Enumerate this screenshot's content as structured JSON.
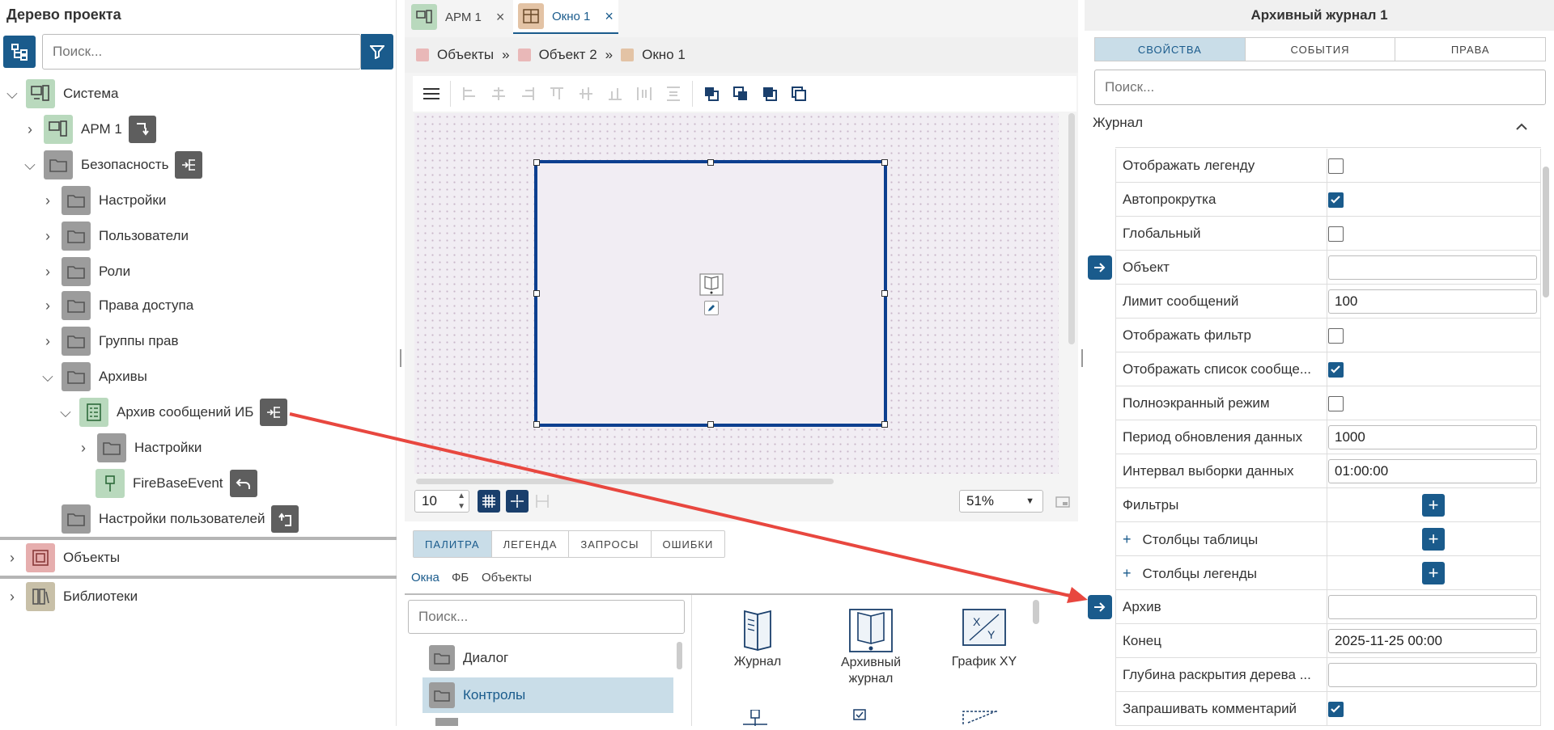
{
  "left": {
    "title": "Дерево проекта",
    "search_placeholder": "Поиск...",
    "tree": [
      {
        "label": "Система",
        "icon": "workstation-icon"
      },
      {
        "label": "АРМ 1",
        "icon": "workstation-icon"
      },
      {
        "label": "Безопасность",
        "icon": "folder-icon"
      },
      {
        "label": "Настройки",
        "icon": "folder-icon"
      },
      {
        "label": "Пользователи",
        "icon": "folder-icon"
      },
      {
        "label": "Роли",
        "icon": "folder-icon"
      },
      {
        "label": "Права доступа",
        "icon": "folder-icon"
      },
      {
        "label": "Группы прав",
        "icon": "folder-icon"
      },
      {
        "label": "Архивы",
        "icon": "folder-icon"
      },
      {
        "label": "Архив сообщений ИБ",
        "icon": "archive-icon"
      },
      {
        "label": "Настройки",
        "icon": "folder-icon"
      },
      {
        "label": "FireBaseEvent",
        "icon": "event-icon"
      },
      {
        "label": "Настройки пользователей",
        "icon": "folder-icon"
      },
      {
        "label": "Объекты",
        "icon": "objects-icon"
      },
      {
        "label": "Библиотеки",
        "icon": "library-icon"
      }
    ]
  },
  "editor": {
    "tabs": [
      {
        "label": "АРМ 1"
      },
      {
        "label": "Окно 1"
      }
    ],
    "breadcrumb": [
      "Объекты",
      "Объект 2",
      "Окно 1"
    ],
    "grid_step": "10",
    "zoom": "51%",
    "palette_tabs": [
      "ПАЛИТРА",
      "ЛЕГЕНДА",
      "ЗАПРОСЫ",
      "ОШИБКИ"
    ],
    "sub_tabs": [
      "Окна",
      "ФБ",
      "Объекты"
    ],
    "palette_search_placeholder": "Поиск...",
    "categories": [
      "Диалог",
      "Контролы"
    ],
    "items": [
      "Журнал",
      "Архивный журнал",
      "График XY"
    ]
  },
  "props": {
    "title": "Архивный журнал 1",
    "tabs": [
      "СВОЙСТВА",
      "СОБЫТИЯ",
      "ПРАВА"
    ],
    "search_placeholder": "Поиск...",
    "section": "Журнал",
    "rows": [
      {
        "label": "Отображать легенду",
        "type": "check",
        "checked": false
      },
      {
        "label": "Автопрокрутка",
        "type": "check",
        "checked": true
      },
      {
        "label": "Глобальный",
        "type": "check",
        "checked": false
      },
      {
        "label": "Объект",
        "type": "input",
        "value": "",
        "link": true
      },
      {
        "label": "Лимит сообщений",
        "type": "input",
        "value": "100"
      },
      {
        "label": "Отображать фильтр",
        "type": "check",
        "checked": false
      },
      {
        "label": "Отображать список сообще...",
        "type": "check",
        "checked": true
      },
      {
        "label": "Полноэкранный режим",
        "type": "check",
        "checked": false
      },
      {
        "label": "Период обновления данных",
        "type": "input",
        "value": "1000"
      },
      {
        "label": "Интервал выборки данных",
        "type": "input",
        "value": "01:00:00"
      },
      {
        "label": "Фильтры",
        "type": "add"
      },
      {
        "label": "Столбцы таблицы",
        "type": "add",
        "expand": "+"
      },
      {
        "label": "Столбцы легенды",
        "type": "add",
        "expand": "+"
      },
      {
        "label": "Архив",
        "type": "input",
        "value": "",
        "link": true
      },
      {
        "label": "Конец",
        "type": "input",
        "value": "2025-11-25 00:00"
      },
      {
        "label": "Глубина раскрытия дерева ...",
        "type": "input",
        "value": ""
      },
      {
        "label": "Запрашивать комментарий",
        "type": "check",
        "checked": true
      }
    ]
  },
  "colors": {
    "accent": "#1a5b8c",
    "selection": "#0d3f8f",
    "arrow": "#e8473f"
  }
}
